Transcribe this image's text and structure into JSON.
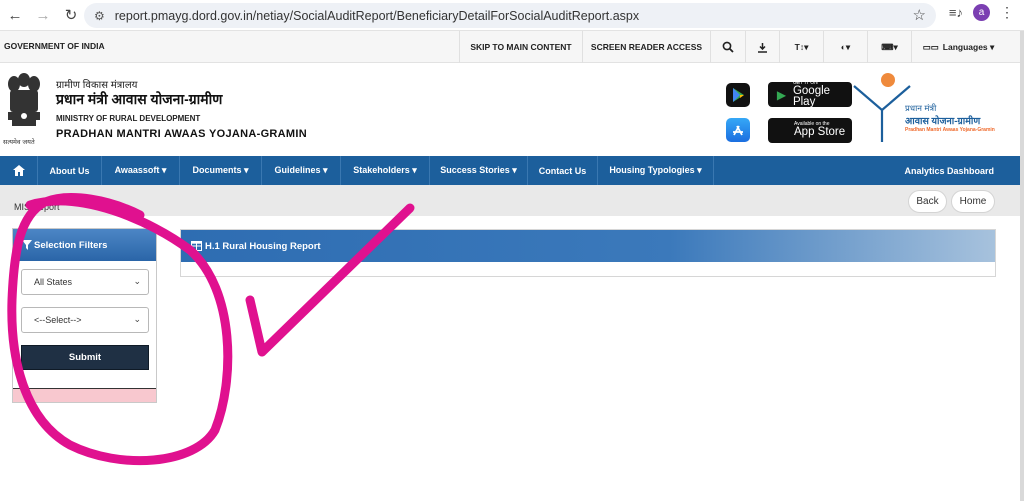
{
  "browser": {
    "url": "report.pmayg.dord.gov.in/netiay/SocialAuditReport/BeneficiaryDetailForSocialAuditReport.aspx",
    "avatar_letter": "a"
  },
  "govbar": {
    "gov_text": "GOVERNMENT OF INDIA",
    "skip": "SKIP TO MAIN CONTENT",
    "screen_reader": "SCREEN READER ACCESS",
    "text_size": "T↕▾",
    "contrast": "◐▾",
    "keyboard": "⌨▾",
    "languages": "Languages ▾"
  },
  "header": {
    "hindi_ministry": "ग्रामीण विकास मंत्रालय",
    "hindi_scheme": "प्रधान मंत्री आवास योजना-ग्रामीण",
    "en_ministry": "MINISTRY OF RURAL DEVELOPMENT",
    "en_scheme": "PRADHAN MANTRI AWAAS YOJANA-GRAMIN",
    "motto": "सत्यमेव जयते",
    "google_play_small": "GET IT ON",
    "google_play": "Google Play",
    "app_store_small": "Available on the",
    "app_store": "App Store",
    "logo_line1": "प्रधान मंत्री",
    "logo_line2": "आवास योजना-ग्रामीण",
    "logo_line3": "Pradhan Mantri Awaas Yojana-Gramin"
  },
  "nav": {
    "items": [
      {
        "label": "About Us"
      },
      {
        "label": "Awaassoft ▾"
      },
      {
        "label": "Documents ▾"
      },
      {
        "label": "Guidelines ▾"
      },
      {
        "label": "Stakeholders ▾"
      },
      {
        "label": "Success Stories ▾"
      },
      {
        "label": "Contact Us"
      },
      {
        "label": "Housing Typologies ▾"
      }
    ],
    "analytics": "Analytics Dashboard"
  },
  "content": {
    "breadcrumb": "MIS Report",
    "back": "Back",
    "home": "Home",
    "filters_title": "Selection Filters",
    "state_select": "All States",
    "select2": "<--Select-->",
    "submit": "Submit",
    "report_title": "H.1 Rural Housing Report"
  },
  "colors": {
    "nav_blue": "#1c5f9c",
    "panel_blue": "#2e6db2",
    "submit_dark": "#1f3044",
    "annotation_magenta": "#e0118f"
  }
}
